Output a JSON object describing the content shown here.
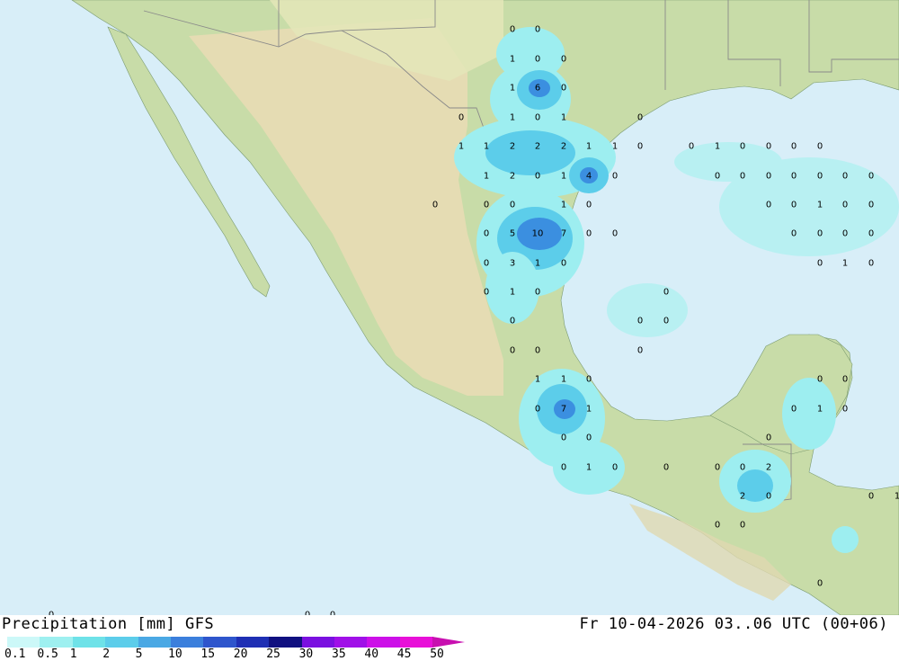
{
  "map": {
    "title": "Precipitation [mm] GFS",
    "datetime": "Fr 10-04-2026 03..06 UTC (00+06)",
    "colors": {
      "ocean": "#d8eef8",
      "land": "#c8dca8",
      "plateau": "#e8dcb4",
      "rain_light": "#9deef0",
      "rain_mid": "#5ccdea",
      "rain_heavy": "#3b8fe0"
    },
    "grid_values": [
      {
        "v": "0"
      },
      {
        "v": "0"
      },
      {
        "v": "1"
      },
      {
        "v": "0"
      },
      {
        "v": "0"
      },
      {
        "v": "1"
      },
      {
        "v": "6"
      },
      {
        "v": "0"
      },
      {
        "v": "0"
      },
      {
        "v": "1"
      },
      {
        "v": "0"
      },
      {
        "v": "1"
      },
      {
        "v": "0"
      },
      {
        "v": "1"
      },
      {
        "v": "1"
      },
      {
        "v": "2"
      },
      {
        "v": "2"
      },
      {
        "v": "2"
      },
      {
        "v": "1"
      },
      {
        "v": "1"
      },
      {
        "v": "0"
      },
      {
        "v": "0"
      },
      {
        "v": "1"
      },
      {
        "v": "0"
      },
      {
        "v": "0"
      },
      {
        "v": "0"
      },
      {
        "v": "0"
      },
      {
        "v": "1"
      },
      {
        "v": "2"
      },
      {
        "v": "0"
      },
      {
        "v": "1"
      },
      {
        "v": "4"
      },
      {
        "v": "0"
      },
      {
        "v": "0"
      },
      {
        "v": "0"
      },
      {
        "v": "0"
      },
      {
        "v": "0"
      },
      {
        "v": "0"
      },
      {
        "v": "0"
      },
      {
        "v": "0"
      },
      {
        "v": "0"
      },
      {
        "v": "0"
      },
      {
        "v": "0"
      },
      {
        "v": "1"
      },
      {
        "v": "0"
      },
      {
        "v": "0"
      },
      {
        "v": "0"
      },
      {
        "v": "1"
      },
      {
        "v": "0"
      },
      {
        "v": "0"
      },
      {
        "v": "0"
      },
      {
        "v": "5"
      },
      {
        "v": "10"
      },
      {
        "v": "7"
      },
      {
        "v": "0"
      },
      {
        "v": "0"
      },
      {
        "v": "0"
      },
      {
        "v": "0"
      },
      {
        "v": "0"
      },
      {
        "v": "0"
      },
      {
        "v": "0"
      },
      {
        "v": "3"
      },
      {
        "v": "1"
      },
      {
        "v": "0"
      },
      {
        "v": "0"
      },
      {
        "v": "1"
      },
      {
        "v": "0"
      },
      {
        "v": "0"
      },
      {
        "v": "1"
      },
      {
        "v": "0"
      },
      {
        "v": "0"
      },
      {
        "v": "0"
      },
      {
        "v": "0"
      },
      {
        "v": "0"
      },
      {
        "v": "0"
      },
      {
        "v": "0"
      },
      {
        "v": "0"
      },
      {
        "v": "1"
      },
      {
        "v": "1"
      },
      {
        "v": "0"
      },
      {
        "v": "0"
      },
      {
        "v": "0"
      },
      {
        "v": "0"
      },
      {
        "v": "7"
      },
      {
        "v": "1"
      },
      {
        "v": "0"
      },
      {
        "v": "1"
      },
      {
        "v": "0"
      },
      {
        "v": "0"
      },
      {
        "v": "0"
      },
      {
        "v": "0"
      },
      {
        "v": "0"
      },
      {
        "v": "1"
      },
      {
        "v": "0"
      },
      {
        "v": "0"
      },
      {
        "v": "0"
      },
      {
        "v": "0"
      },
      {
        "v": "2"
      },
      {
        "v": "2"
      },
      {
        "v": "0"
      },
      {
        "v": "0"
      },
      {
        "v": "1"
      },
      {
        "v": "0"
      },
      {
        "v": "0"
      },
      {
        "v": "0"
      },
      {
        "v": "0"
      },
      {
        "v": "0"
      },
      {
        "v": "0"
      }
    ]
  },
  "legend": {
    "swatches": [
      {
        "color": "#ccf8f8"
      },
      {
        "color": "#9ef0f0"
      },
      {
        "color": "#6ee2e8"
      },
      {
        "color": "#5ccdea"
      },
      {
        "color": "#4aa8e4"
      },
      {
        "color": "#3b7fdc"
      },
      {
        "color": "#2e55cc"
      },
      {
        "color": "#1f2fb4"
      },
      {
        "color": "#101080"
      },
      {
        "color": "#7a10e0"
      },
      {
        "color": "#a010e8"
      },
      {
        "color": "#cc10e8"
      },
      {
        "color": "#e810d8"
      },
      {
        "color": "#c810b0"
      }
    ],
    "labels": [
      "0.1",
      "0.5",
      "1",
      "2",
      "5",
      "10",
      "15",
      "20",
      "25",
      "30",
      "35",
      "40",
      "45",
      "50"
    ]
  }
}
